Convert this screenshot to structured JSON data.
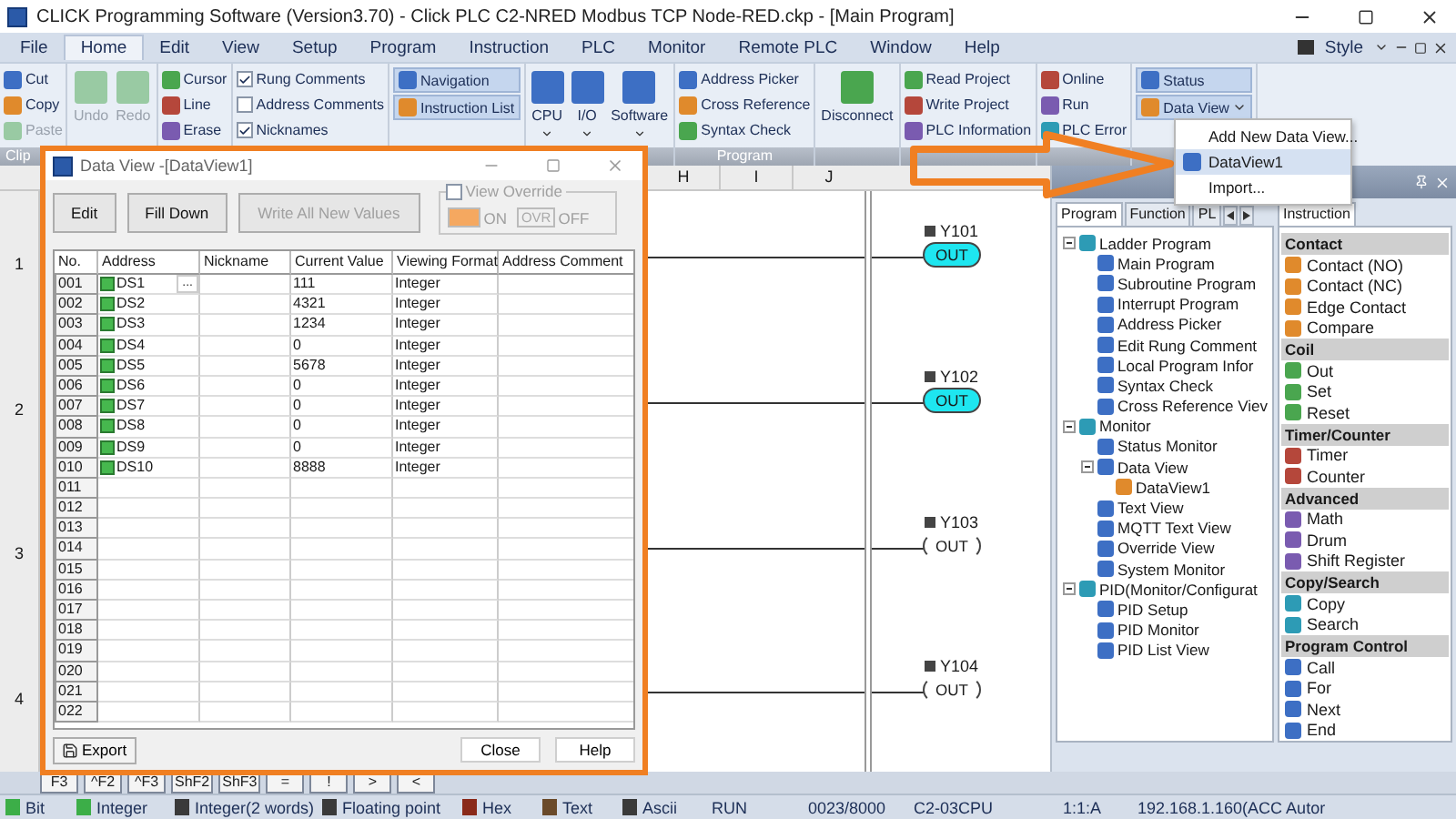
{
  "window": {
    "title": "CLICK Programming Software (Version3.70) - Click PLC C2-NRED Modbus TCP Node-RED.ckp - [Main Program]"
  },
  "menu": [
    {
      "label": "File",
      "selected": false
    },
    {
      "label": "Home",
      "selected": true
    },
    {
      "label": "Edit",
      "selected": false
    },
    {
      "label": "View",
      "selected": false
    },
    {
      "label": "Setup",
      "selected": false
    },
    {
      "label": "Program",
      "selected": false
    },
    {
      "label": "Instruction",
      "selected": false
    },
    {
      "label": "PLC",
      "selected": false
    },
    {
      "label": "Monitor",
      "selected": false
    },
    {
      "label": "Remote PLC",
      "selected": false
    },
    {
      "label": "Window",
      "selected": false
    },
    {
      "label": "Help",
      "selected": false
    }
  ],
  "style_menu": {
    "label": "Style"
  },
  "ribbon": [
    {
      "label": "Clip",
      "columns": [
        [
          {
            "kind": "small",
            "label": "Cut",
            "disabled": false
          },
          {
            "kind": "small",
            "label": "Copy",
            "disabled": false
          },
          {
            "kind": "small",
            "label": "Paste",
            "disabled": true
          }
        ]
      ]
    },
    {
      "columns": [
        [
          {
            "kind": "large",
            "label": "Undo",
            "disabled": true,
            "menu": false
          }
        ],
        [
          {
            "kind": "large",
            "label": "Redo",
            "disabled": true,
            "menu": false
          }
        ]
      ]
    },
    {
      "columns": [
        [
          {
            "kind": "small",
            "label": "Cursor",
            "disabled": false
          },
          {
            "kind": "small",
            "label": "Line",
            "disabled": false
          },
          {
            "kind": "small",
            "label": "Erase",
            "disabled": false
          }
        ]
      ]
    },
    {
      "columns": [
        [
          {
            "kind": "check",
            "label": "Rung Comments",
            "checked": true
          },
          {
            "kind": "check",
            "label": "Address Comments",
            "checked": false
          },
          {
            "kind": "check",
            "label": "Nicknames",
            "checked": true
          }
        ]
      ]
    },
    {
      "columns": [
        [
          {
            "kind": "toggle",
            "label": "Navigation",
            "selected": true,
            "menu": false
          },
          {
            "kind": "toggle",
            "label": "Instruction List",
            "selected": true,
            "menu": false
          }
        ]
      ]
    },
    {
      "columns": [
        [
          {
            "kind": "large",
            "label": "CPU",
            "disabled": false,
            "menu": true
          }
        ],
        [
          {
            "kind": "large",
            "label": "I/O",
            "disabled": false,
            "menu": true
          }
        ],
        [
          {
            "kind": "large",
            "label": "Software",
            "disabled": false,
            "menu": true
          }
        ]
      ]
    },
    {
      "label": "Program",
      "columns": [
        [
          {
            "kind": "small",
            "label": "Address Picker",
            "disabled": false
          },
          {
            "kind": "small",
            "label": "Cross Reference",
            "disabled": false
          },
          {
            "kind": "small",
            "label": "Syntax Check",
            "disabled": false
          }
        ]
      ]
    },
    {
      "columns": [
        [
          {
            "kind": "large",
            "label": "Disconnect",
            "disabled": false,
            "menu": false
          }
        ]
      ]
    },
    {
      "columns": [
        [
          {
            "kind": "small",
            "label": "Read Project",
            "disabled": false
          },
          {
            "kind": "small",
            "label": "Write Project",
            "disabled": false
          },
          {
            "kind": "small",
            "label": "PLC Information",
            "disabled": false
          }
        ]
      ]
    },
    {
      "columns": [
        [
          {
            "kind": "small",
            "label": "Online",
            "disabled": false
          },
          {
            "kind": "small",
            "label": "Run",
            "disabled": false
          },
          {
            "kind": "small",
            "label": "PLC Error",
            "disabled": false
          }
        ]
      ]
    },
    {
      "columns": [
        [
          {
            "kind": "toggle",
            "label": "Status",
            "selected": true,
            "menu": false
          },
          {
            "kind": "toggle",
            "label": "Data View",
            "selected": true,
            "menu": true
          }
        ]
      ]
    }
  ],
  "ladder": {
    "columns": [
      "H",
      "I",
      "J"
    ],
    "rungs": [
      {
        "number": "1",
        "coil": {
          "address": "Y101",
          "label": "OUT",
          "energized": true
        }
      },
      {
        "number": "2",
        "coil": {
          "address": "Y102",
          "label": "OUT",
          "energized": true
        }
      },
      {
        "number": "3",
        "coil": {
          "address": "Y103",
          "label": "OUT",
          "energized": false
        }
      },
      {
        "number": "4",
        "coil": {
          "address": "Y104",
          "label": "OUT",
          "energized": false
        }
      }
    ]
  },
  "navigation": {
    "tabs": [
      {
        "label": "Program",
        "selected": true
      },
      {
        "label": "Function",
        "selected": false
      },
      {
        "label": "PL",
        "selected": false
      }
    ],
    "tree": [
      {
        "label": "Ladder Program",
        "expanded": true,
        "children": [
          {
            "label": "Main Program"
          },
          {
            "label": "Subroutine Program"
          },
          {
            "label": "Interrupt Program"
          },
          {
            "label": "Address Picker"
          },
          {
            "label": "Edit Rung Comment"
          },
          {
            "label": "Local Program Infor"
          },
          {
            "label": "Syntax Check"
          },
          {
            "label": "Cross Reference Viev"
          }
        ]
      },
      {
        "label": "Monitor",
        "expanded": true,
        "children": [
          {
            "label": "Status Monitor"
          },
          {
            "label": "Data View",
            "expanded": true,
            "children": [
              {
                "label": "DataView1"
              }
            ]
          },
          {
            "label": "Text View"
          },
          {
            "label": "MQTT Text View"
          },
          {
            "label": "Override View"
          },
          {
            "label": "System Monitor"
          }
        ]
      },
      {
        "label": "PID(Monitor/Configurat",
        "expanded": true,
        "children": [
          {
            "label": "PID Setup"
          },
          {
            "label": "PID Monitor"
          },
          {
            "label": "PID List View"
          }
        ]
      }
    ]
  },
  "instruction_list": {
    "tab": "Instruction",
    "sections": [
      {
        "title": "Contact",
        "items": [
          "Contact (NO)",
          "Contact (NC)",
          "Edge Contact",
          "Compare"
        ]
      },
      {
        "title": "Coil",
        "items": [
          "Out",
          "Set",
          "Reset"
        ]
      },
      {
        "title": "Timer/Counter",
        "items": [
          "Timer",
          "Counter"
        ]
      },
      {
        "title": "Advanced",
        "items": [
          "Math",
          "Drum",
          "Shift Register"
        ]
      },
      {
        "title": "Copy/Search",
        "items": [
          "Copy",
          "Search"
        ]
      },
      {
        "title": "Program Control",
        "items": [
          "Call",
          "For",
          "Next",
          "End"
        ]
      }
    ]
  },
  "data_view_menu": [
    {
      "label": "Add New Data View...",
      "kind": "command",
      "selected": false
    },
    {
      "label": "DataView1",
      "kind": "view",
      "selected": true
    },
    {
      "label": "Import...",
      "kind": "command",
      "selected": false
    }
  ],
  "data_view": {
    "title": "Data View -[DataView1]",
    "buttons": [
      {
        "label": "Edit",
        "disabled": false
      },
      {
        "label": "Fill Down",
        "disabled": false
      },
      {
        "label": "Write All New Values",
        "disabled": true
      }
    ],
    "override": {
      "label": "View Override",
      "checked": false,
      "disabled": true,
      "options": [
        {
          "label": "ON",
          "active": true
        },
        {
          "box": "OVR",
          "label": "OFF",
          "active": false
        }
      ]
    },
    "columns": [
      "No.",
      "Address",
      "Nickname",
      "Current Value",
      "Viewing Format",
      "Address Comment"
    ],
    "rows": [
      {
        "no": "001",
        "address": "DS1",
        "browse": "...",
        "value": "111",
        "format": "Integer"
      },
      {
        "no": "002",
        "address": "DS2",
        "value": "4321",
        "format": "Integer"
      },
      {
        "no": "003",
        "address": "DS3",
        "value": "1234",
        "format": "Integer"
      },
      {
        "no": "004",
        "address": "DS4",
        "value": "0",
        "format": "Integer"
      },
      {
        "no": "005",
        "address": "DS5",
        "value": "5678",
        "format": "Integer"
      },
      {
        "no": "006",
        "address": "DS6",
        "value": "0",
        "format": "Integer"
      },
      {
        "no": "007",
        "address": "DS7",
        "value": "0",
        "format": "Integer"
      },
      {
        "no": "008",
        "address": "DS8",
        "value": "0",
        "format": "Integer"
      },
      {
        "no": "009",
        "address": "DS9",
        "value": "0",
        "format": "Integer"
      },
      {
        "no": "010",
        "address": "DS10",
        "value": "8888",
        "format": "Integer"
      },
      {
        "no": "011"
      },
      {
        "no": "012"
      },
      {
        "no": "013"
      },
      {
        "no": "014"
      },
      {
        "no": "015"
      },
      {
        "no": "016"
      },
      {
        "no": "017"
      },
      {
        "no": "018"
      },
      {
        "no": "019"
      },
      {
        "no": "020"
      },
      {
        "no": "021"
      },
      {
        "no": "022"
      }
    ],
    "export": "Export",
    "footer_buttons": [
      "Close",
      "Help"
    ]
  },
  "function_keys": [
    "F3",
    "^F2",
    "^F3",
    "ShF2",
    "ShF3",
    "=",
    "!",
    ">",
    "<"
  ],
  "status_bar": [
    {
      "label": "Bit",
      "kind": "format",
      "color": "#3cae48"
    },
    {
      "label": "Integer",
      "kind": "format",
      "color": "#3cae48"
    },
    {
      "label": "Integer(2 words)",
      "kind": "format",
      "color": "#3a3a3a"
    },
    {
      "label": "Floating point",
      "kind": "format",
      "color": "#3a3a3a"
    },
    {
      "label": "Hex",
      "kind": "format",
      "color": "#8a2a1a"
    },
    {
      "label": "Text",
      "kind": "format",
      "color": "#6a4a2a"
    },
    {
      "label": "Ascii",
      "kind": "format",
      "color": "#3a3a3a"
    },
    {
      "label": "RUN",
      "kind": "field"
    },
    {
      "label": "0023/8000",
      "kind": "field"
    },
    {
      "label": "C2-03CPU",
      "kind": "field"
    },
    {
      "label": "1:1:A",
      "kind": "field"
    },
    {
      "label": "192.168.1.160(ACC Autor",
      "kind": "field"
    }
  ]
}
